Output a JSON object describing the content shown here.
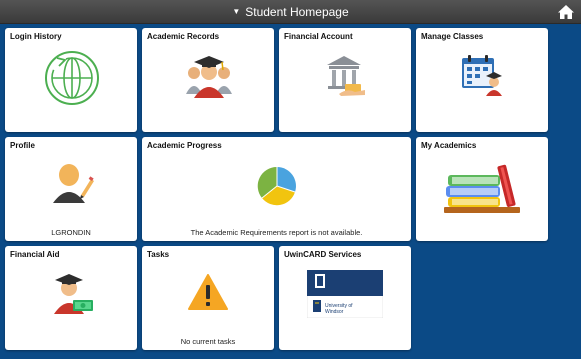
{
  "header": {
    "title": "Student Homepage",
    "caret_icon": "triangle-down-icon",
    "home_icon": "home-icon",
    "background": "#3f3f3f"
  },
  "page": {
    "background": "#0b4a86"
  },
  "tiles": {
    "login_history": {
      "label": "Login History",
      "icon": "history-globe-icon"
    },
    "academic_records": {
      "label": "Academic Records",
      "icon": "graduates-icon"
    },
    "financial_account": {
      "label": "Financial Account",
      "icon": "bank-payment-icon"
    },
    "manage_classes": {
      "label": "Manage Classes",
      "icon": "calendar-student-icon"
    },
    "profile": {
      "label": "Profile",
      "icon": "person-pencil-icon",
      "footer": "LGRONDIN"
    },
    "academic_progress": {
      "label": "Academic Progress",
      "icon": "pie-chart-icon",
      "footer": "The Academic Requirements report is not available."
    },
    "my_academics": {
      "label": "My Academics",
      "icon": "books-icon"
    },
    "financial_aid": {
      "label": "Financial Aid",
      "icon": "graduate-money-icon"
    },
    "tasks": {
      "label": "Tasks",
      "icon": "warning-icon",
      "footer": "No current tasks"
    },
    "uwincard": {
      "label": "UwinCARD Services",
      "icon": "university-card-icon",
      "card_text": "University of Windsor"
    }
  }
}
